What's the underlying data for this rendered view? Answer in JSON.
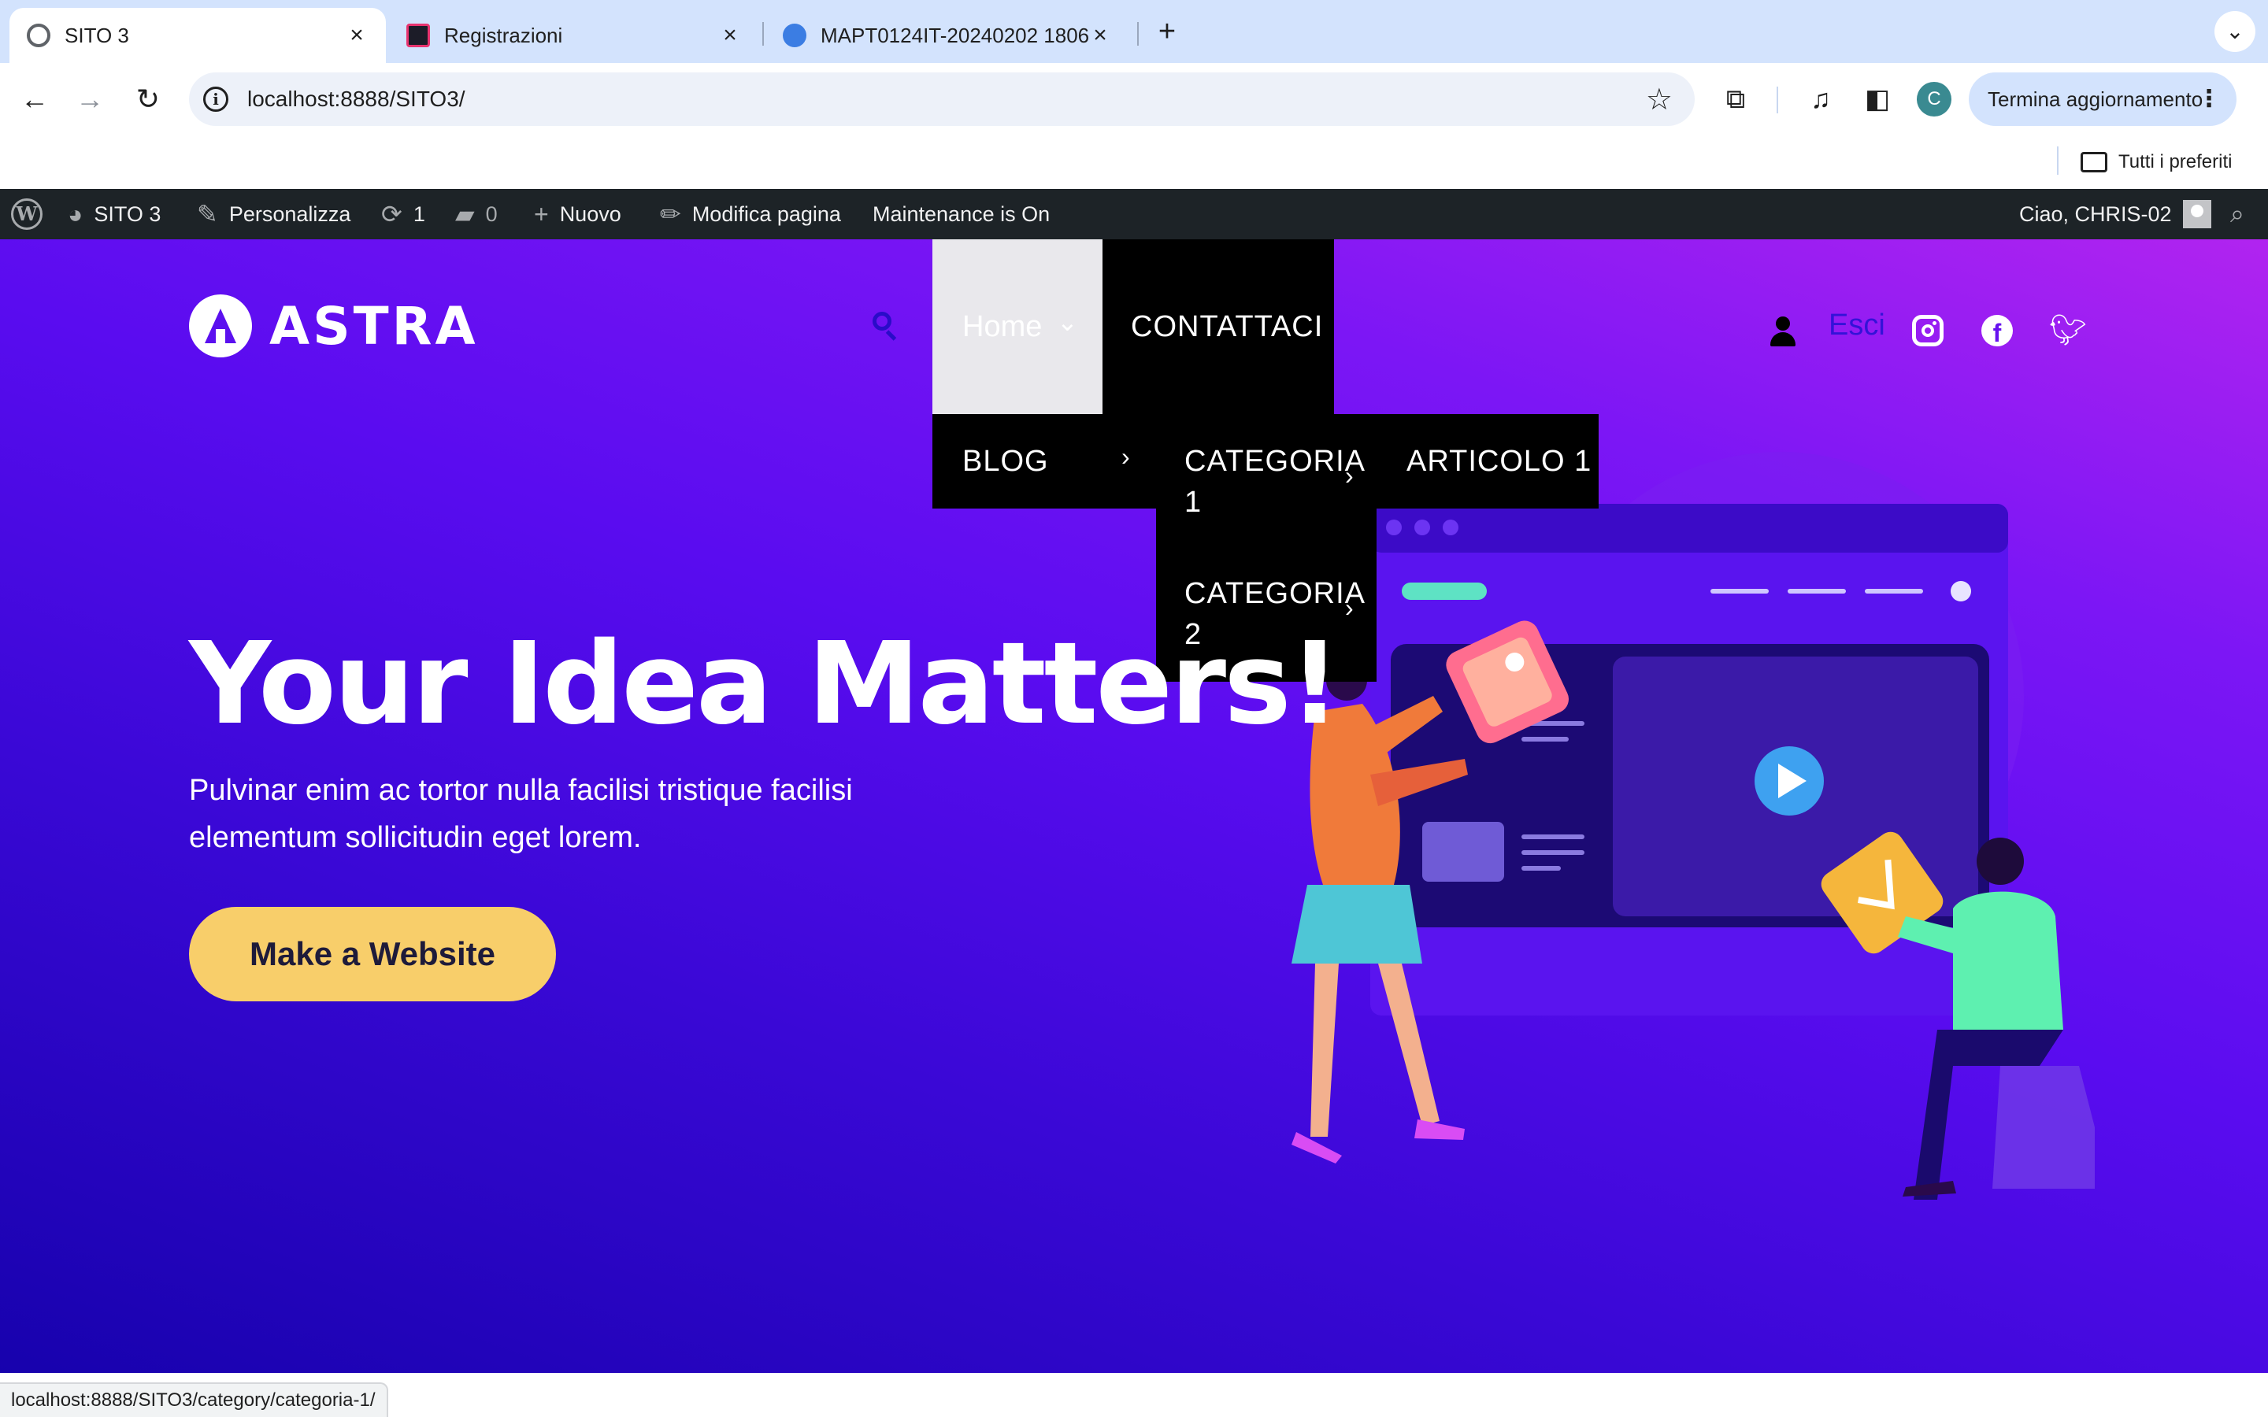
{
  "browser": {
    "tabs": [
      {
        "title": "SITO 3",
        "active": true
      },
      {
        "title": "Registrazioni",
        "active": false
      },
      {
        "title": "MAPT0124IT-20240202 1806",
        "active": false
      }
    ],
    "new_tab_label": "+",
    "url": "localhost:8888/SITO3/",
    "update_button": "Termina aggiornamento",
    "profile_initial": "C",
    "bookmarks_all": "Tutti i preferiti",
    "status_url": "localhost:8888/SITO3/category/categoria-1/"
  },
  "adminbar": {
    "site_name": "SITO 3",
    "customize": "Personalizza",
    "updates_count": "1",
    "comments_count": "0",
    "new": "Nuovo",
    "edit_page": "Modifica pagina",
    "maintenance": "Maintenance is On",
    "greeting": "Ciao, CHRIS-02"
  },
  "site": {
    "logo_text": "ASTRA",
    "nav": {
      "home": "Home",
      "contact": "CONTATTACI",
      "blog": "BLOG",
      "categoria1": "CATEGORIA 1",
      "categoria2": "CATEGORIA 2",
      "articolo1": "ARTICOLO 1"
    },
    "logout": "Esci",
    "hero_title": "Your Idea Matters!",
    "hero_subtitle": "Pulvinar enim ac tortor nulla facilisi tristique facilisi elementum sollicitudin eget lorem.",
    "cta": "Make a Website"
  },
  "colors": {
    "accent_yellow": "#f8ce6a",
    "admin_bar": "#1d2327",
    "tab_strip": "#d3e3fd"
  },
  "icons": [
    "wordpress-icon",
    "dashboard-icon",
    "brush-icon",
    "refresh-icon",
    "comment-icon",
    "plus-icon",
    "pencil-icon",
    "search-icon",
    "user-icon",
    "instagram-icon",
    "facebook-icon",
    "twitter-icon",
    "play-icon"
  ]
}
